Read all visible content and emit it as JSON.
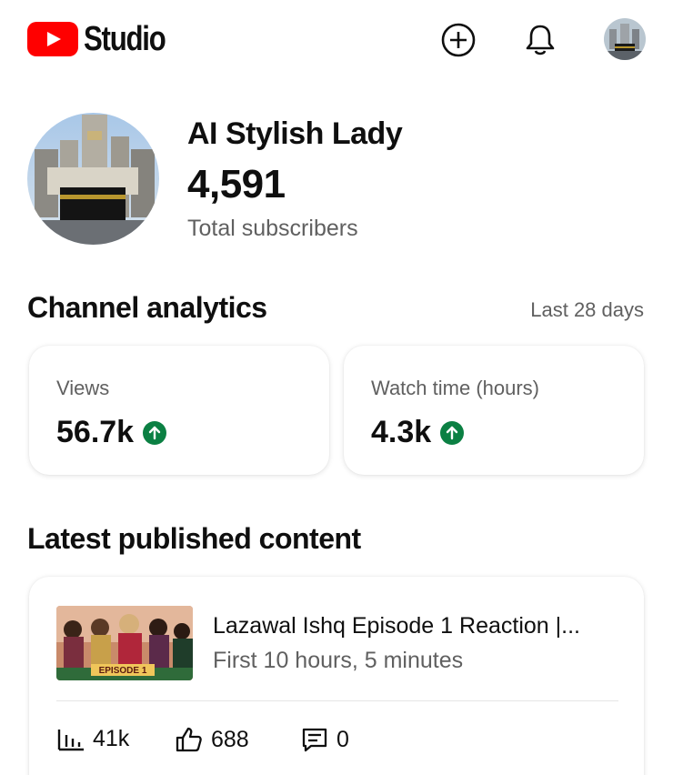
{
  "header": {
    "app_name": "Studio",
    "create_icon": "create-plus-circle-icon",
    "notifications_icon": "bell-icon",
    "account_icon": "account-avatar"
  },
  "channel": {
    "name": "AI Stylish Lady",
    "subscribers": "4,591",
    "subscribers_label": "Total subscribers"
  },
  "analytics": {
    "title": "Channel analytics",
    "range": "Last 28 days",
    "cards": [
      {
        "label": "Views",
        "value": "56.7k",
        "trend": "up"
      },
      {
        "label": "Watch time (hours)",
        "value": "4.3k",
        "trend": "up"
      }
    ]
  },
  "latest": {
    "title": "Latest published content",
    "video": {
      "title": "Lazawal Ishq Episode 1 Reaction |...",
      "subtitle": "First 10 hours, 5 minutes",
      "thumbnail_text": "EPISODE 1",
      "views": "41k",
      "likes": "688",
      "comments": "0"
    }
  },
  "colors": {
    "brand_red": "#ff0000",
    "trend_green": "#0b8043",
    "secondary_text": "#606060"
  }
}
